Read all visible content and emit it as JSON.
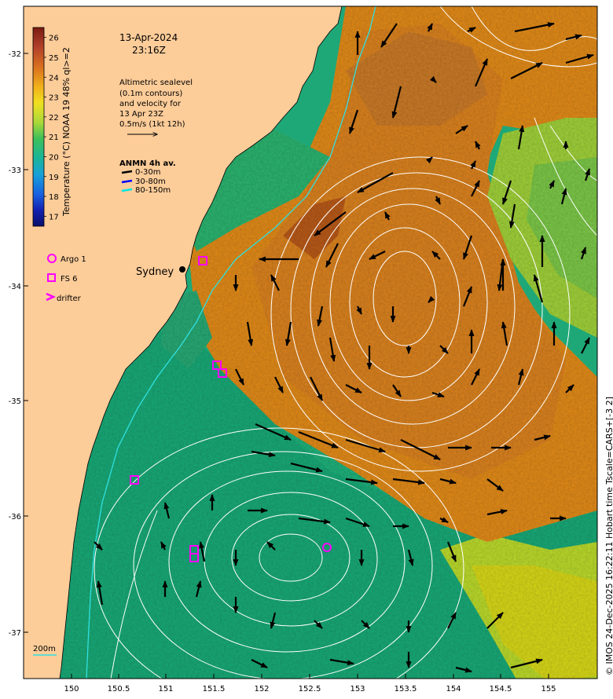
{
  "header": {
    "date": "13-Apr-2024",
    "time": "23:16Z"
  },
  "altimetry_note": {
    "lines": [
      "Altimetric sealevel",
      "(0.1m contours)",
      "and velocity for",
      "13 Apr 23Z",
      "0.5m/s (1kt 12h)"
    ]
  },
  "anmn_legend": {
    "title": "ANMN 4h av.",
    "items": [
      {
        "label": "0-30m",
        "color": "#000000"
      },
      {
        "label": "30-80m",
        "color": "#0000ff"
      },
      {
        "label": "80-150m",
        "color": "#00e5e5"
      }
    ]
  },
  "markers_legend": {
    "items": [
      {
        "label": "Argo 1",
        "symbol": "circle",
        "color": "#ff00ff"
      },
      {
        "label": "FS 6",
        "symbol": "square",
        "color": "#ff00ff"
      },
      {
        "label": "drifter",
        "symbol": "chevron",
        "color": "#ff00ff"
      }
    ]
  },
  "colorbar": {
    "label": "Temperature (°C) NOAA 19 48% ql>=2",
    "ticks": [
      "26",
      "25",
      "24",
      "23",
      "22",
      "21",
      "20",
      "19",
      "18",
      "17"
    ],
    "range": [
      16.5,
      26.5
    ]
  },
  "city_label": "Sydney",
  "scale_label": "200m",
  "axes": {
    "x_ticks": [
      "150",
      "150.5",
      "151",
      "151.5",
      "152",
      "152.5",
      "153",
      "153.5",
      "154",
      "154.5",
      "155"
    ],
    "y_ticks": [
      "-32",
      "-33",
      "-34",
      "-35",
      "-36",
      "-37"
    ]
  },
  "credit": "© IMOS 24-Dec-2025 16:22:11 Hobart time Tscale=CARS+[-3 2]",
  "colors": {
    "land": "#fccc99",
    "warm": "#e08a1e",
    "hot": "#b85a1a",
    "cool": "#1ea878",
    "mid": "#dcd820",
    "marker": "#ff00ff"
  }
}
